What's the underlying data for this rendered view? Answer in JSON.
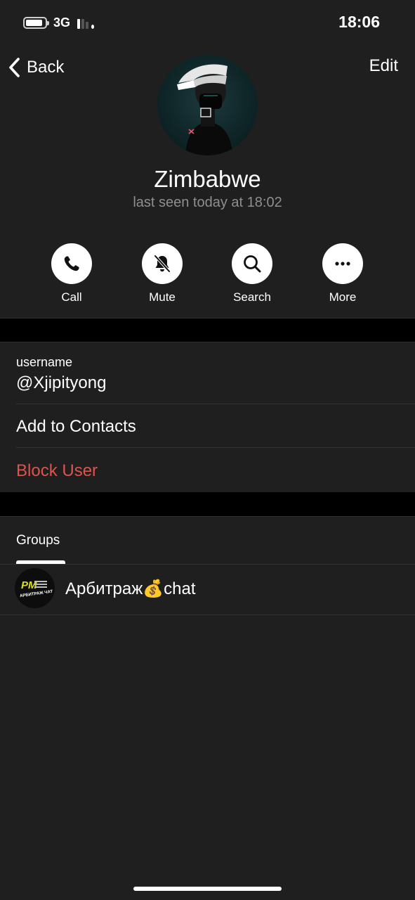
{
  "status_bar": {
    "network": "3G",
    "time": "18:06",
    "battery_level": 0.75
  },
  "nav": {
    "back_label": "Back",
    "edit_label": "Edit"
  },
  "profile": {
    "name": "Zimbabwe",
    "last_seen": "last seen today at 18:02",
    "avatar_icon": "user-photo"
  },
  "actions": [
    {
      "label": "Call",
      "icon": "phone-icon"
    },
    {
      "label": "Mute",
      "icon": "bell-slash-icon"
    },
    {
      "label": "Search",
      "icon": "search-icon"
    },
    {
      "label": "More",
      "icon": "more-icon"
    }
  ],
  "info": {
    "username_label": "username",
    "username_value": "@Xjipityong",
    "add_to_contacts": "Add to Contacts",
    "block_user": "Block User"
  },
  "tabs": {
    "groups": "Groups"
  },
  "groups": [
    {
      "name": "Арбитраж💰chat",
      "avatar_text": "PM",
      "avatar_subtext": "АРБИТРАЖ ЧАТ"
    }
  ],
  "colors": {
    "background": "#1f1f1f",
    "separator": "#000000",
    "danger": "#e0524c",
    "secondary_text": "#8e8e93"
  }
}
